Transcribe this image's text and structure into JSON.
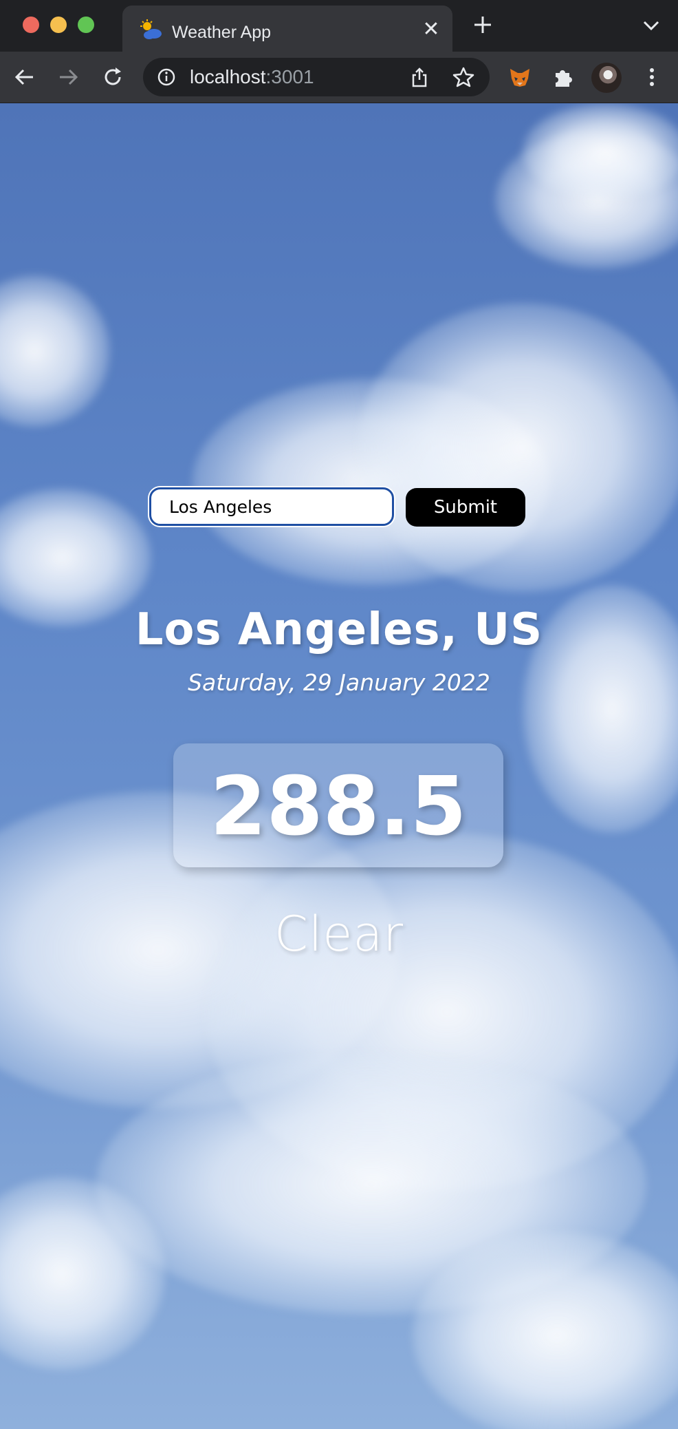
{
  "browser": {
    "tab": {
      "title": "Weather App",
      "favicon": "weather-sun-cloud-icon"
    },
    "address": {
      "host": "localhost",
      "port": ":3001"
    },
    "icons": [
      "back-arrow-icon",
      "forward-arrow-icon",
      "reload-icon",
      "site-info-icon",
      "share-icon",
      "bookmark-star-icon",
      "metamask-fox-icon",
      "extensions-puzzle-icon",
      "profile-avatar",
      "menu-kebab-icon",
      "new-tab-plus-icon",
      "tab-search-chevron-icon",
      "tab-close-icon"
    ]
  },
  "search": {
    "value": "Los Angeles",
    "submit_label": "Submit"
  },
  "weather": {
    "location": "Los Angeles, US",
    "date": "Saturday, 29 January 2022",
    "temperature": "288.5",
    "condition": "Clear"
  },
  "colors": {
    "chrome_dark": "#202124",
    "chrome_toolbar": "#35363a",
    "sky_blue": "#5e86c8",
    "input_border": "#1f4fa3",
    "button_bg": "#000000"
  }
}
